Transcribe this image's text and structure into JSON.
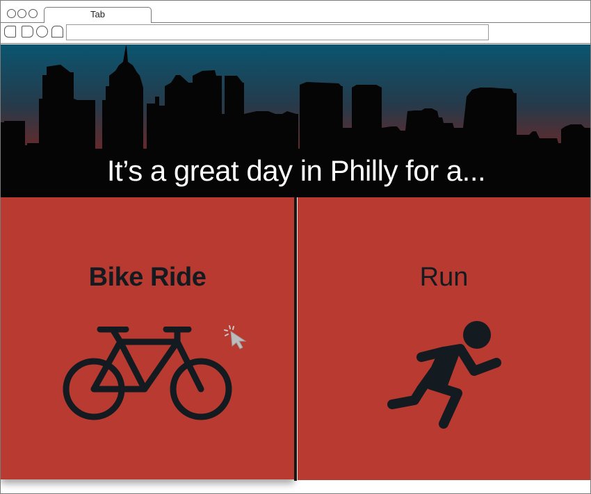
{
  "browser": {
    "tab_label": "Tab",
    "address_value": ""
  },
  "hero": {
    "headline": "It’s a great day in Philly for a..."
  },
  "options": {
    "bike_label": "Bike Ride",
    "run_label": "Run"
  },
  "colors": {
    "panel_red": "#b83a30",
    "icon_dark": "#131a20",
    "sky_top": "#0a5570",
    "sky_bottom": "#9a2a20"
  },
  "icons": {
    "bike": "bicycle-icon",
    "run": "runner-icon",
    "cursor": "click-cursor-icon"
  }
}
